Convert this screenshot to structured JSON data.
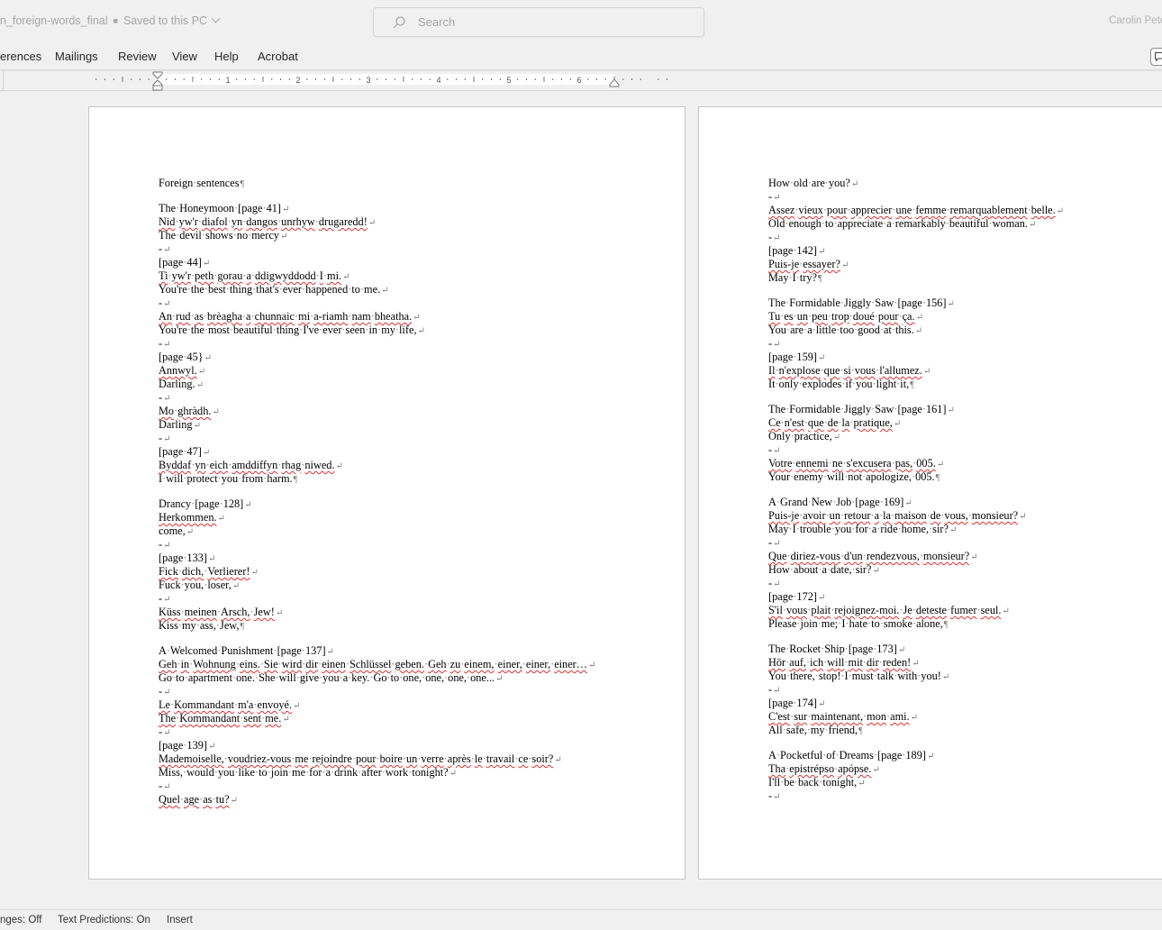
{
  "titlebar": {
    "doc_name": "n_foreign-words_final",
    "save_status": "Saved to this PC",
    "search_placeholder": "Search",
    "user_name": "Carolin Pete"
  },
  "ribbon": {
    "tabs": [
      "erences",
      "Mailings",
      "Review",
      "View",
      "Help",
      "Acrobat"
    ]
  },
  "ruler": {
    "numbers": [
      "1",
      "2",
      "3",
      "4",
      "5",
      "6"
    ]
  },
  "page1": {
    "lines": [
      {
        "t": "Foreign sentences",
        "end": "pilcrow"
      },
      {
        "gap": true
      },
      {
        "t": "The Honeymoon [page 41]",
        "end": "break"
      },
      {
        "t": "Nid yw'r diafol yn dangos unrhyw drugaredd!",
        "end": "break",
        "err": true
      },
      {
        "t": "The devil shows no mercy",
        "end": "break"
      },
      {
        "t": "-",
        "end": "break"
      },
      {
        "t": "[page 44]",
        "end": "break"
      },
      {
        "t": "Ti yw'r peth gorau a ddigwyddodd I mi.",
        "end": "break",
        "err": true
      },
      {
        "t": "You're the best thing that's ever happened to me.",
        "end": "break"
      },
      {
        "t": "-",
        "end": "break"
      },
      {
        "t": "An rud as brèagha a chunnaic mi a-riamh nam bheatha.",
        "end": "break",
        "err": true
      },
      {
        "t": "You're the most beautiful thing I've ever seen in my life,",
        "end": "break"
      },
      {
        "t": "-",
        "end": "break"
      },
      {
        "t": "[page 45}",
        "end": "break"
      },
      {
        "t": "Annwyl.",
        "end": "break",
        "err": true
      },
      {
        "t": "Darling.",
        "end": "break"
      },
      {
        "t": "-",
        "end": "break"
      },
      {
        "t": "Mo ghràdh.",
        "end": "break",
        "err": true
      },
      {
        "t": "Darling",
        "end": "break"
      },
      {
        "t": "-",
        "end": "break"
      },
      {
        "t": "[page 47]",
        "end": "break"
      },
      {
        "t": "Byddaf yn eich amddiffyn rhag niwed.",
        "end": "break",
        "err": true
      },
      {
        "t": "I will protect you from harm.",
        "end": "pilcrow"
      },
      {
        "gap": true
      },
      {
        "t": "Drancy [page 128]",
        "end": "break"
      },
      {
        "t": "Herkommen.",
        "end": "break",
        "err": true
      },
      {
        "t": "come,",
        "end": "break"
      },
      {
        "t": "-",
        "end": "break"
      },
      {
        "t": "[page 133]",
        "end": "break"
      },
      {
        "t": "Fick dich, Verlierer!",
        "end": "break",
        "err": true
      },
      {
        "t": "Fuck you, loser,",
        "end": "break"
      },
      {
        "t": "-",
        "end": "break"
      },
      {
        "t": "Küss meinen Arsch, Jew!",
        "end": "break",
        "err": true
      },
      {
        "t": "Kiss my ass, Jew,",
        "end": "pilcrow"
      },
      {
        "gap": true
      },
      {
        "t": "A Welcomed Punishment [page 137]",
        "end": "break"
      },
      {
        "t": "Geh in Wohnung eins. Sie wird dir einen Schlüssel geben. Geh zu einem, einer, einer, einer…",
        "end": "break",
        "err": true
      },
      {
        "t": "Go to apartment one. She will give you a key. Go to one, one, one, one...",
        "end": "break"
      },
      {
        "t": "-",
        "end": "break"
      },
      {
        "t": "Le Kommandant m'a envoyé.",
        "end": "break",
        "err": true
      },
      {
        "t": "The Kommandant sent me.",
        "end": "break",
        "err": true
      },
      {
        "t": "-",
        "end": "break"
      },
      {
        "t": "[page 139]",
        "end": "break"
      },
      {
        "t": "Mademoiselle, voudriez-vous me rejoindre pour boire un verre après le travail ce soir?",
        "end": "break",
        "err": true
      },
      {
        "t": "Miss, would you like to join me for a drink after work tonight?",
        "end": "break"
      },
      {
        "t": "-",
        "end": "break"
      },
      {
        "t": "Quel age as tu?",
        "end": "break",
        "err": true
      }
    ]
  },
  "page2": {
    "lines": [
      {
        "t": "How old are you?",
        "end": "break"
      },
      {
        "t": "-",
        "end": "break"
      },
      {
        "t": "Assez vieux pour apprecier une femme remarquablement belle.",
        "end": "break",
        "err": true
      },
      {
        "t": "Old enough to appreciate a remarkably beautiful woman.",
        "end": "break"
      },
      {
        "t": "-",
        "end": "break"
      },
      {
        "t": "[page 142]",
        "end": "break"
      },
      {
        "t": "Puis-je essayer?",
        "end": "break",
        "err": true
      },
      {
        "t": "May I try?",
        "end": "pilcrow"
      },
      {
        "gap": true
      },
      {
        "t": "The Formidable Jiggly Saw [page 156]",
        "end": "break"
      },
      {
        "t": "Tu es un peu trop doué pour ça.",
        "end": "break",
        "err": true
      },
      {
        "t": "You are a little too good at this.",
        "end": "break"
      },
      {
        "t": "-",
        "end": "break"
      },
      {
        "t": "[page 159]",
        "end": "break"
      },
      {
        "t": "Il n'explose que si vous l'allumez.",
        "end": "break",
        "err": true
      },
      {
        "t": "It only explodes if you light it,",
        "end": "pilcrow"
      },
      {
        "gap": true
      },
      {
        "t": "The Formidable Jiggly Saw [page 161]",
        "end": "break"
      },
      {
        "t": "Ce n'est que de la pratique,",
        "end": "break",
        "err": true
      },
      {
        "t": "Only practice,",
        "end": "break"
      },
      {
        "t": "-",
        "end": "break"
      },
      {
        "t": "Votre ennemi ne s'excusera pas, 005.",
        "end": "break",
        "err": true
      },
      {
        "t": "Your enemy will not apologize, 005.",
        "end": "pilcrow"
      },
      {
        "gap": true
      },
      {
        "t": "A Grand New Job [page 169]",
        "end": "break"
      },
      {
        "t": "Puis-je avoir un retour a la maison de vous, monsieur?",
        "end": "break",
        "err": true
      },
      {
        "t": "May I trouble you for a ride home, sir?",
        "end": "break"
      },
      {
        "t": "-",
        "end": "break"
      },
      {
        "t": "Que diriez-vous d'un rendezvous, monsieur?",
        "end": "break",
        "err": true
      },
      {
        "t": "How about a date, sir?",
        "end": "break"
      },
      {
        "t": "-",
        "end": "break"
      },
      {
        "t": "[page 172]",
        "end": "break"
      },
      {
        "t": "S'il vous plait rejoignez-moi. Je deteste fumer seul.",
        "end": "break",
        "err": true
      },
      {
        "t": "Please join me; I hate to smoke alone,",
        "end": "pilcrow"
      },
      {
        "gap": true
      },
      {
        "t": "The Rocket Ship [page 173]",
        "end": "break"
      },
      {
        "t": "Hör auf, ich will mit dir reden!",
        "end": "break",
        "err": true
      },
      {
        "t": "You there, stop! I must talk with you!",
        "end": "break"
      },
      {
        "t": "-",
        "end": "break"
      },
      {
        "t": "[page 174]",
        "end": "break"
      },
      {
        "t": "C'est sur maintenant, mon ami.",
        "end": "break",
        "err": true
      },
      {
        "t": "All safe, my friend,",
        "end": "pilcrow"
      },
      {
        "gap": true
      },
      {
        "t": "A Pocketful of Dreams [page 189]",
        "end": "break"
      },
      {
        "t": "Tha epistrépso apópse.",
        "end": "break",
        "err": true
      },
      {
        "t": "I'll be back tonight,",
        "end": "break"
      },
      {
        "t": "-",
        "end": "break"
      }
    ]
  },
  "statusbar": {
    "track_changes": "nges: Off",
    "text_predictions": "Text Predictions: On",
    "mode": "Insert"
  },
  "colors": {
    "background": "#f0f0f0",
    "page": "#ffffff",
    "spell_error": "#e03030",
    "formatting_marks": "#7f7f7f"
  }
}
